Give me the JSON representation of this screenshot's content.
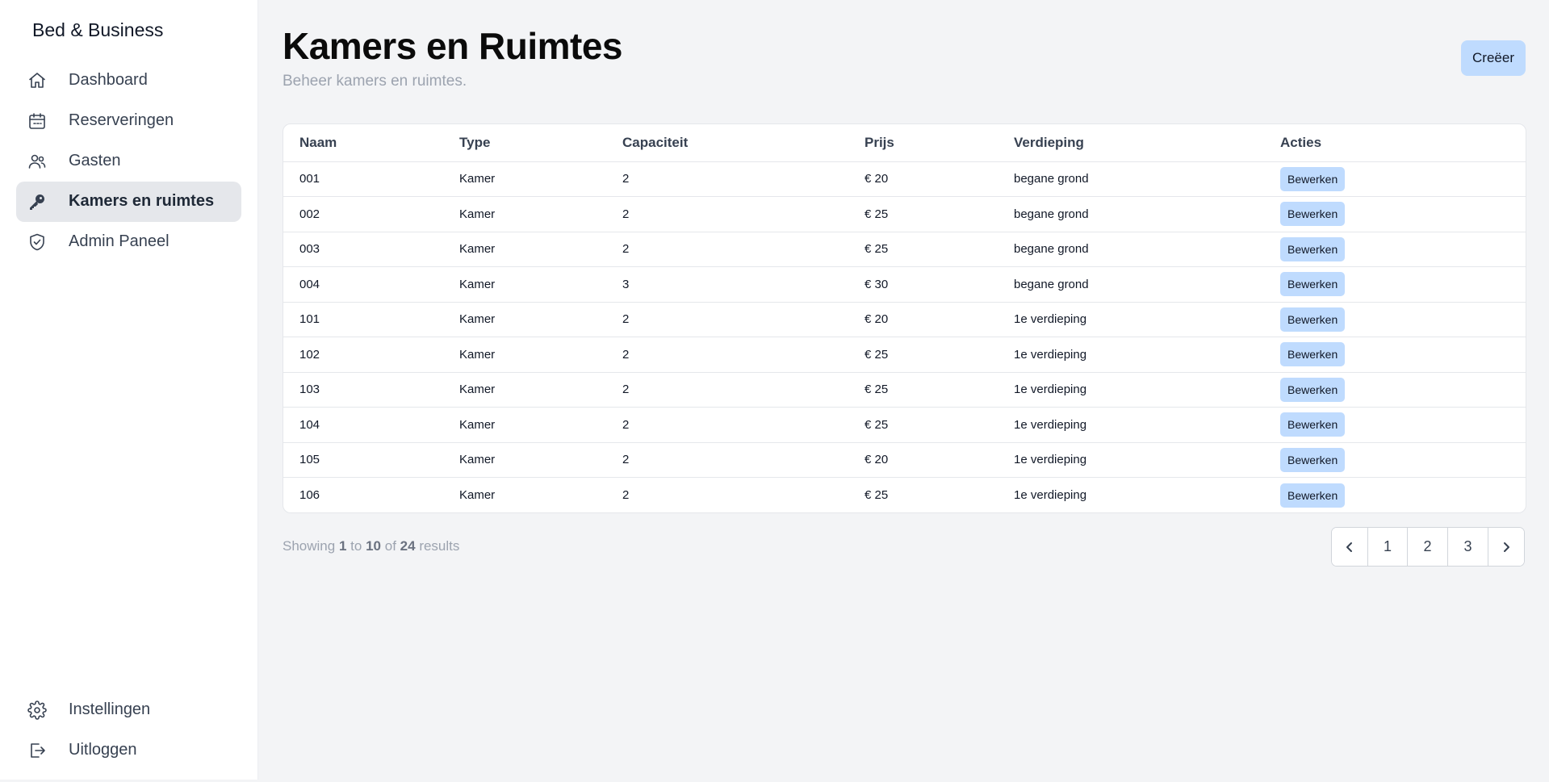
{
  "app": {
    "brand": "Bed & Business"
  },
  "sidebar": {
    "items": [
      {
        "label": "Dashboard",
        "icon": "home-icon"
      },
      {
        "label": "Reserveringen",
        "icon": "calendar-icon"
      },
      {
        "label": "Gasten",
        "icon": "users-icon"
      },
      {
        "label": "Kamers en ruimtes",
        "icon": "key-icon",
        "active": true
      },
      {
        "label": "Admin Paneel",
        "icon": "shield-check-icon"
      }
    ],
    "bottom_items": [
      {
        "label": "Instellingen",
        "icon": "gear-icon"
      },
      {
        "label": "Uitloggen",
        "icon": "logout-icon"
      }
    ]
  },
  "header": {
    "title": "Kamers en Ruimtes",
    "subtitle": "Beheer kamers en ruimtes.",
    "create_label": "Creëer"
  },
  "table": {
    "columns": [
      "Naam",
      "Type",
      "Capaciteit",
      "Prijs",
      "Verdieping",
      "Acties"
    ],
    "action_label": "Bewerken",
    "rows": [
      [
        "001",
        "Kamer",
        "2",
        "€ 20",
        "begane grond"
      ],
      [
        "002",
        "Kamer",
        "2",
        "€ 25",
        "begane grond"
      ],
      [
        "003",
        "Kamer",
        "2",
        "€ 25",
        "begane grond"
      ],
      [
        "004",
        "Kamer",
        "3",
        "€ 30",
        "begane grond"
      ],
      [
        "101",
        "Kamer",
        "2",
        "€ 20",
        "1e verdieping"
      ],
      [
        "102",
        "Kamer",
        "2",
        "€ 25",
        "1e verdieping"
      ],
      [
        "103",
        "Kamer",
        "2",
        "€ 25",
        "1e verdieping"
      ],
      [
        "104",
        "Kamer",
        "2",
        "€ 25",
        "1e verdieping"
      ],
      [
        "105",
        "Kamer",
        "2",
        "€ 20",
        "1e verdieping"
      ],
      [
        "106",
        "Kamer",
        "2",
        "€ 25",
        "1e verdieping"
      ]
    ]
  },
  "results": {
    "prefix": "Showing",
    "from": "1",
    "to_word": "to",
    "to": "10",
    "of_word": "of",
    "total": "24",
    "suffix": "results"
  },
  "pagination": {
    "pages": [
      "1",
      "2",
      "3"
    ],
    "prev_icon": "chevron-left-icon",
    "next_icon": "chevron-right-icon"
  },
  "colors": {
    "accent_button": "#bfdbfe",
    "sidebar_active": "#e5e7eb",
    "background": "#f3f4f6"
  }
}
